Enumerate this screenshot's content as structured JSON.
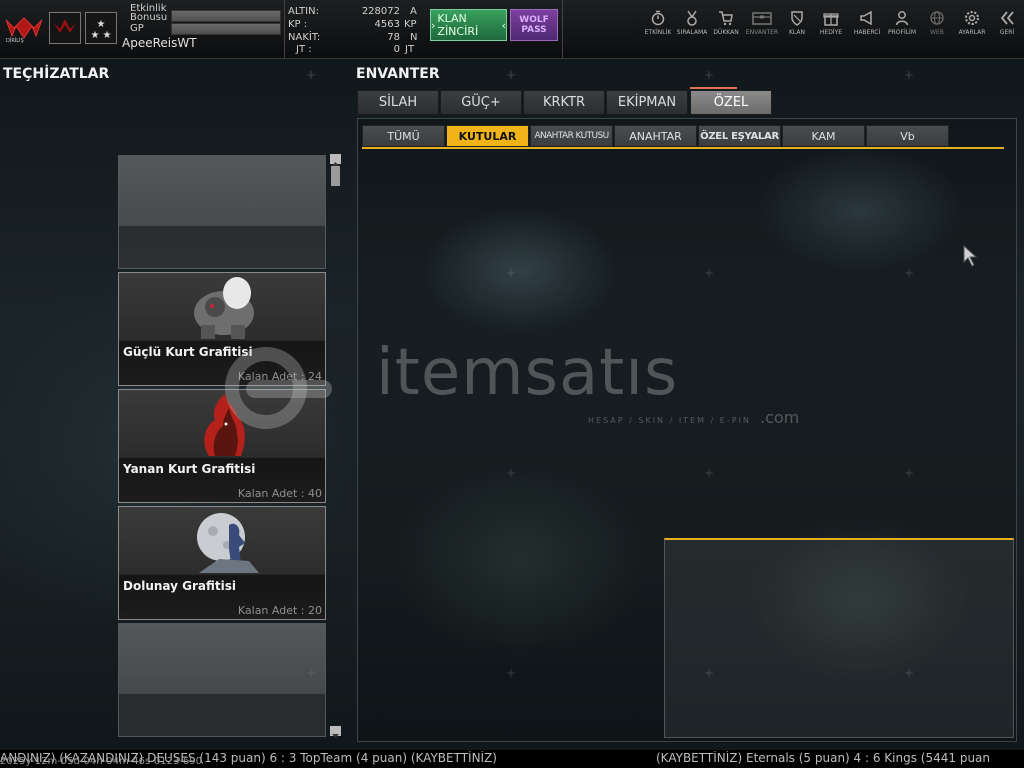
{
  "topbar": {
    "logo_text": "DİRİLİŞ",
    "event_bonus_label_1": "Etkinlik",
    "event_bonus_label_2": "Bonusu",
    "gp_label": "GP",
    "username": "ApeeReisWT",
    "currencies": [
      {
        "label": "ALTIN:",
        "value": "228072",
        "unit": "A"
      },
      {
        "label": "KP  :",
        "value": "4563",
        "unit": "KP"
      },
      {
        "label": "NAKİT:",
        "value": "78",
        "unit": "N"
      },
      {
        "label": "JT  :",
        "value": "0",
        "unit": "JT"
      }
    ],
    "klan_button": "KLAN ZİNCİRİ",
    "wolf_button_1": "WOLF",
    "wolf_button_2": "PASS",
    "nav": [
      {
        "label": "ETKİNLİK",
        "icon": "stopwatch-icon"
      },
      {
        "label": "SIRALAMA",
        "icon": "medal-icon"
      },
      {
        "label": "DÜKKAN",
        "icon": "cart-icon"
      },
      {
        "label": "ENVANTER",
        "icon": "inventory-icon"
      },
      {
        "label": "KLAN",
        "icon": "shield-icon"
      },
      {
        "label": "HEDİYE",
        "icon": "gift-icon"
      },
      {
        "label": "HABERCİ",
        "icon": "megaphone-icon"
      },
      {
        "label": "PROFİLİM",
        "icon": "profile-icon"
      },
      {
        "label": "WEB",
        "icon": "globe-icon"
      },
      {
        "label": "AYARLAR",
        "icon": "gear-icon"
      },
      {
        "label": "GERİ",
        "icon": "back-arrow-icon"
      }
    ]
  },
  "equipment": {
    "title": "TEÇHİZATLAR",
    "items": [
      {
        "name": "",
        "count": ""
      },
      {
        "name": "Güçlü Kurt Grafitisi",
        "count": "Kalan Adet : 24"
      },
      {
        "name": "Yanan Kurt Grafitisi",
        "count": "Kalan Adet : 40"
      },
      {
        "name": "Dolunay Grafitisi",
        "count": "Kalan Adet : 20"
      },
      {
        "name": "",
        "count": ""
      }
    ]
  },
  "inventory": {
    "title": "ENVANTER",
    "tabs": [
      "SİLAH",
      "GÜÇ+",
      "KRKTR",
      "EKİPMAN",
      "ÖZEL"
    ],
    "active_tab": "ÖZEL",
    "subtabs": [
      "TÜMÜ",
      "KUTULAR",
      "ANAHTAR KUTUSU",
      "ANAHTAR",
      "ÖZEL EŞYALAR",
      "KAM",
      "Vb"
    ],
    "active_subtab": "KUTULAR"
  },
  "watermark": {
    "brand": "itemsatıs",
    "tagline": "HESAP / SKIN / ITEM / E-PIN",
    "domain": ".com"
  },
  "ticker": {
    "text_left": "ANDINIZ) (KAZANDINIZ) DEUSES (143 puan) 6 : 3 TopTeam (4 puan) (KAYBETTİNİZ)",
    "text_right": "(KAYBETTİNİZ) Eternals (5 puan) 4 : 6 Kings (5441 puan",
    "timestamp": "2025y-12m-05d-04h-04m-46s-0123-690"
  },
  "colors": {
    "accent": "#e4b020",
    "klan_green": "#2b8a4c",
    "wolf_purple": "#6a3590",
    "active_subtab": "#f0b418"
  }
}
